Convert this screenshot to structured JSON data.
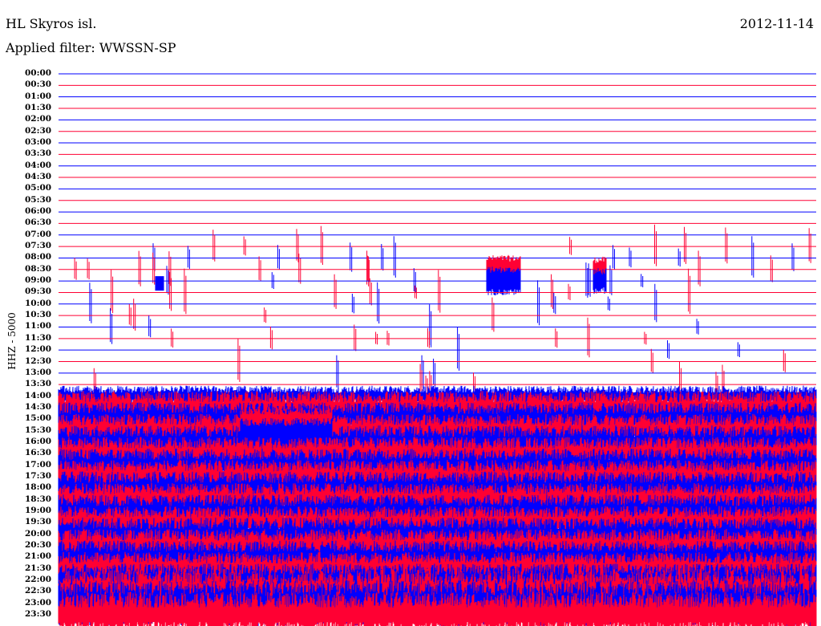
{
  "header": {
    "station": "HL Skyros isl.",
    "filter": "Applied filter: WWSSN-SP",
    "date": "2012-11-14"
  },
  "chart_data": {
    "type": "line",
    "title": "HL Skyros isl.",
    "subtitle": "Applied filter: WWSSN-SP",
    "date": "2012-11-14",
    "ylabel": "HHZ - 5000",
    "xlabel": "",
    "row_labels": [
      "00:00",
      "00:30",
      "01:00",
      "01:30",
      "02:00",
      "02:30",
      "03:00",
      "03:30",
      "04:00",
      "04:30",
      "05:00",
      "05:30",
      "06:00",
      "06:30",
      "07:00",
      "07:30",
      "08:00",
      "08:30",
      "09:00",
      "09:30",
      "10:00",
      "10:30",
      "11:00",
      "11:30",
      "12:00",
      "12:30",
      "13:00",
      "13:30",
      "14:00",
      "14:30",
      "15:00",
      "15:30",
      "16:00",
      "16:30",
      "17:00",
      "17:30",
      "18:00",
      "18:30",
      "19:00",
      "19:30",
      "20:00",
      "20:30",
      "21:00",
      "21:30",
      "22:00",
      "22:30",
      "23:00",
      "23:30"
    ],
    "series_colors": [
      "#0000ff",
      "#ff0033"
    ],
    "noise_onset": "14:00",
    "minutes_per_row": 30
  }
}
